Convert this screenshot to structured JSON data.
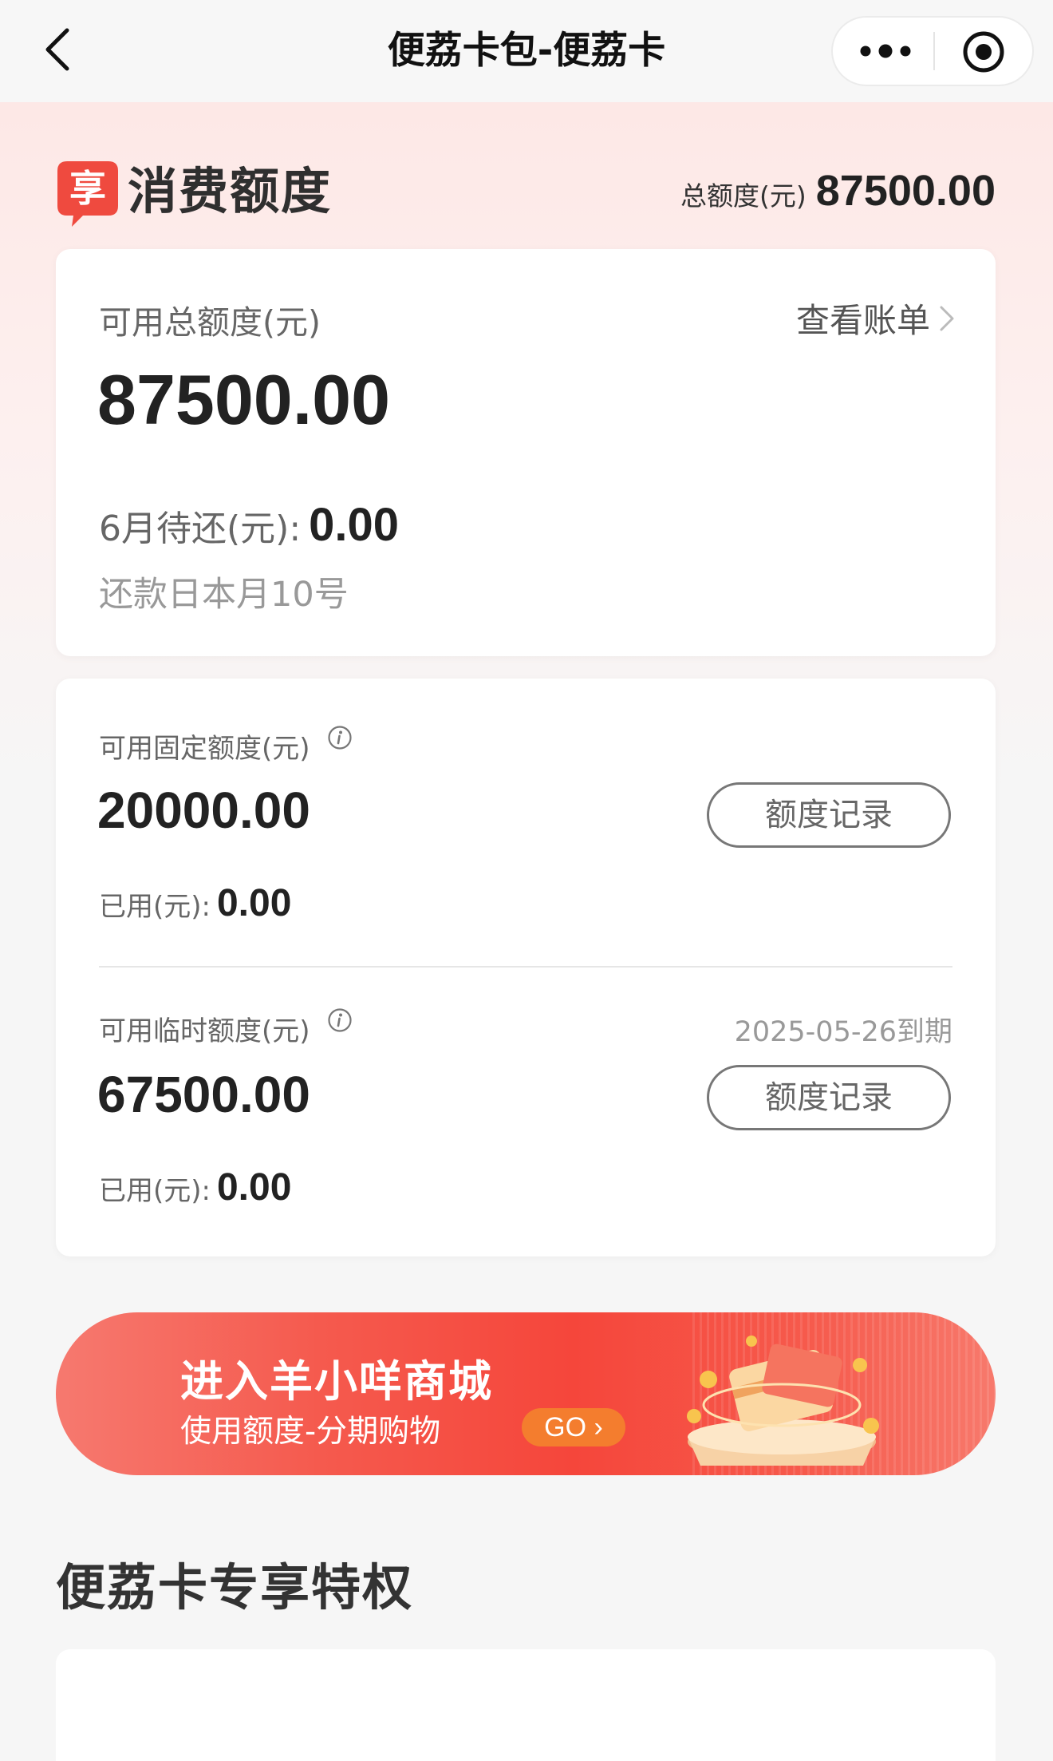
{
  "nav": {
    "title": "便荔卡包-便荔卡",
    "back_icon": "chevron-left-icon",
    "more_icon": "more-dots-icon",
    "target_icon": "close-target-icon"
  },
  "header": {
    "logo_icon": "share-badge-icon",
    "logo_text": "享",
    "title": "消费额度",
    "total_label": "总额度(元)",
    "total_value": "87500.00"
  },
  "summary": {
    "available_label": "可用总额度(元)",
    "view_bill": "查看账单",
    "available_value": "87500.00",
    "due_label": "6月待还(元):",
    "due_value": "0.00",
    "repay_date": "还款日本月10号"
  },
  "fixed_quota": {
    "label": "可用固定额度(元)",
    "value": "20000.00",
    "record_button": "额度记录",
    "used_label": "已用(元):",
    "used_value": "0.00"
  },
  "temp_quota": {
    "label": "可用临时额度(元)",
    "expiry": "2025-05-26到期",
    "value": "67500.00",
    "record_button": "额度记录",
    "used_label": "已用(元):",
    "used_value": "0.00"
  },
  "banner": {
    "title": "进入羊小咩商城",
    "subtitle": "使用额度-分期购物",
    "go_label": "GO"
  },
  "privileges": {
    "title": "便荔卡专享特权"
  },
  "colors": {
    "accent_red": "#f5463b",
    "go_orange": "#f47d2e",
    "logo_red": "#ef4a3f"
  }
}
